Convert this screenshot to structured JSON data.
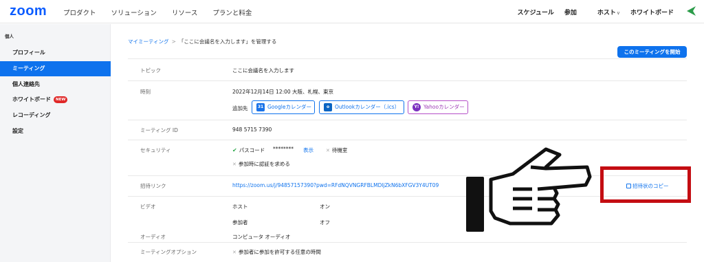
{
  "header": {
    "logo": "zoom",
    "nav_left": [
      "プロダクト",
      "ソリューション",
      "リソース",
      "プランと料金"
    ],
    "nav_right": {
      "schedule": "スケジュール",
      "join": "参加",
      "host": "ホスト",
      "whiteboard": "ホワイトボード"
    },
    "brand_color": "#0b5cff"
  },
  "sidebar": {
    "heading": "個人",
    "items": [
      {
        "label": "プロフィール"
      },
      {
        "label": "ミーティング",
        "active": true
      },
      {
        "label": "個人連絡先"
      },
      {
        "label": "ホワイトボード",
        "badge": "NEW"
      },
      {
        "label": "レコーディング"
      },
      {
        "label": "設定"
      }
    ],
    "active_color": "#0e72ed"
  },
  "breadcrumb": {
    "parent": "マイミーティング",
    "separator": ">",
    "current": "「ここに会議名を入力します」を管理する"
  },
  "start_button": "このミーティングを開始",
  "details": {
    "topic": {
      "label": "トピック",
      "value": "ここに会議名を入力します"
    },
    "time": {
      "label": "時刻",
      "value": "2022年12月14日 12:00 大阪、札幌、東京",
      "add_to": "追加先",
      "calendars": [
        {
          "label": "Googleカレンダー",
          "icon": "google-calendar-icon",
          "icon_text": "31"
        },
        {
          "label": "Outlookカレンダー（.ics）",
          "icon": "outlook-icon",
          "icon_text": "o"
        },
        {
          "label": "Yahooカレンダー",
          "icon": "yahoo-icon",
          "icon_text": "Y!"
        }
      ]
    },
    "meeting_id": {
      "label": "ミーティング ID",
      "value": "948 5715 7390"
    },
    "security": {
      "label": "セキュリティ",
      "passcode_label": "パスコード",
      "passcode_value": "********",
      "show": "表示",
      "waiting_room": "待機室",
      "require_auth": "参加時に認証を求める"
    },
    "invite_link": {
      "label": "招待リンク",
      "value": "https://zoom.us/j/94857157390?pwd=RFdNQVNGRFBLMDljZkN6bXFGV3Y4UT09",
      "copy": "招待状のコピー"
    },
    "video": {
      "label": "ビデオ",
      "host_label": "ホスト",
      "host_value": "オン",
      "participant_label": "参加者",
      "participant_value": "オフ"
    },
    "audio": {
      "label": "オーディオ",
      "value": "コンピュータ オーディオ"
    },
    "options": {
      "label": "ミーティングオプション",
      "value": "参加者に参加を許可する任意の時間"
    }
  },
  "highlight_color": "#c40d12"
}
